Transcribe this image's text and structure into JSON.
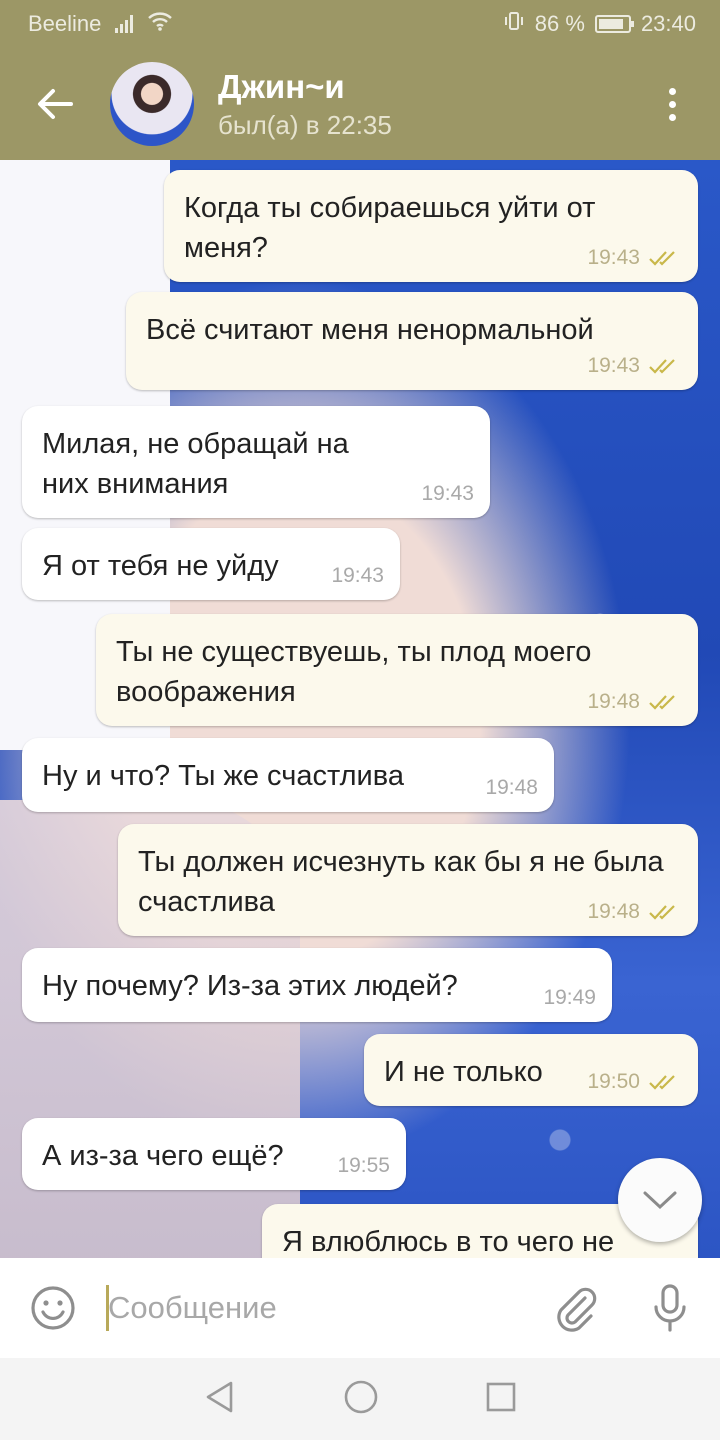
{
  "status_bar": {
    "carrier": "Beeline",
    "battery": "86 %",
    "time": "23:40"
  },
  "header": {
    "contact_name": "Джин~и",
    "last_seen": "был(а) в 22:35"
  },
  "messages": [
    {
      "dir": "out",
      "text": "Когда ты собираешься уйти от меня?",
      "time": "19:43",
      "read": true
    },
    {
      "dir": "out",
      "text": "Всё считают меня ненормальной",
      "time": "19:43",
      "read": true
    },
    {
      "dir": "in",
      "text": "Милая, не обращай на них внимания",
      "time": "19:43"
    },
    {
      "dir": "in",
      "text": "Я от тебя не уйду",
      "time": "19:43"
    },
    {
      "dir": "out",
      "text": "Ты не существуешь, ты плод моего воображения",
      "time": "19:48",
      "read": true
    },
    {
      "dir": "in",
      "text": "Ну и что? Ты же счастлива",
      "time": "19:48"
    },
    {
      "dir": "out",
      "text": "Ты должен исчезнуть как бы я не была счастлива",
      "time": "19:48",
      "read": true
    },
    {
      "dir": "in",
      "text": "Ну почему? Из-за этих людей?",
      "time": "19:49"
    },
    {
      "dir": "out",
      "text": "И не только",
      "time": "19:50",
      "read": true
    },
    {
      "dir": "in",
      "text": "А из-за чего ещё?",
      "time": "19:55"
    },
    {
      "dir": "out",
      "text": "Я влюблюсь в то чего не"
    }
  ],
  "composer": {
    "placeholder": "Сообщение",
    "value": ""
  },
  "icons": {
    "back": "arrow-left-icon",
    "menu": "more-vertical-icon",
    "scroll_down": "chevron-down-icon",
    "emoji": "smiley-icon",
    "attach": "paperclip-icon",
    "mic": "microphone-icon",
    "nav_back": "triangle-back-icon",
    "nav_home": "circle-home-icon",
    "nav_recents": "square-recents-icon"
  },
  "colors": {
    "header": "#9c9766",
    "outgoing_bubble": "#fcf9ec",
    "incoming_bubble": "#ffffff",
    "read_ticks": "#c9b84a"
  }
}
